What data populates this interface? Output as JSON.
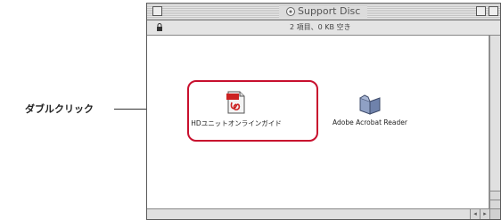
{
  "window": {
    "title": "Support Disc",
    "info": "2 項目、0 KB 空き"
  },
  "items": [
    {
      "label": "HDユニットオンラインガイド",
      "icon": "pdf-document-icon"
    },
    {
      "label": "Adobe Acrobat Reader",
      "icon": "folder-icon"
    }
  ],
  "annotation": {
    "label": "ダブルクリック"
  },
  "colors": {
    "highlight": "#c8102e",
    "folder": "#7b8db5",
    "pdf": "#cc2222"
  }
}
